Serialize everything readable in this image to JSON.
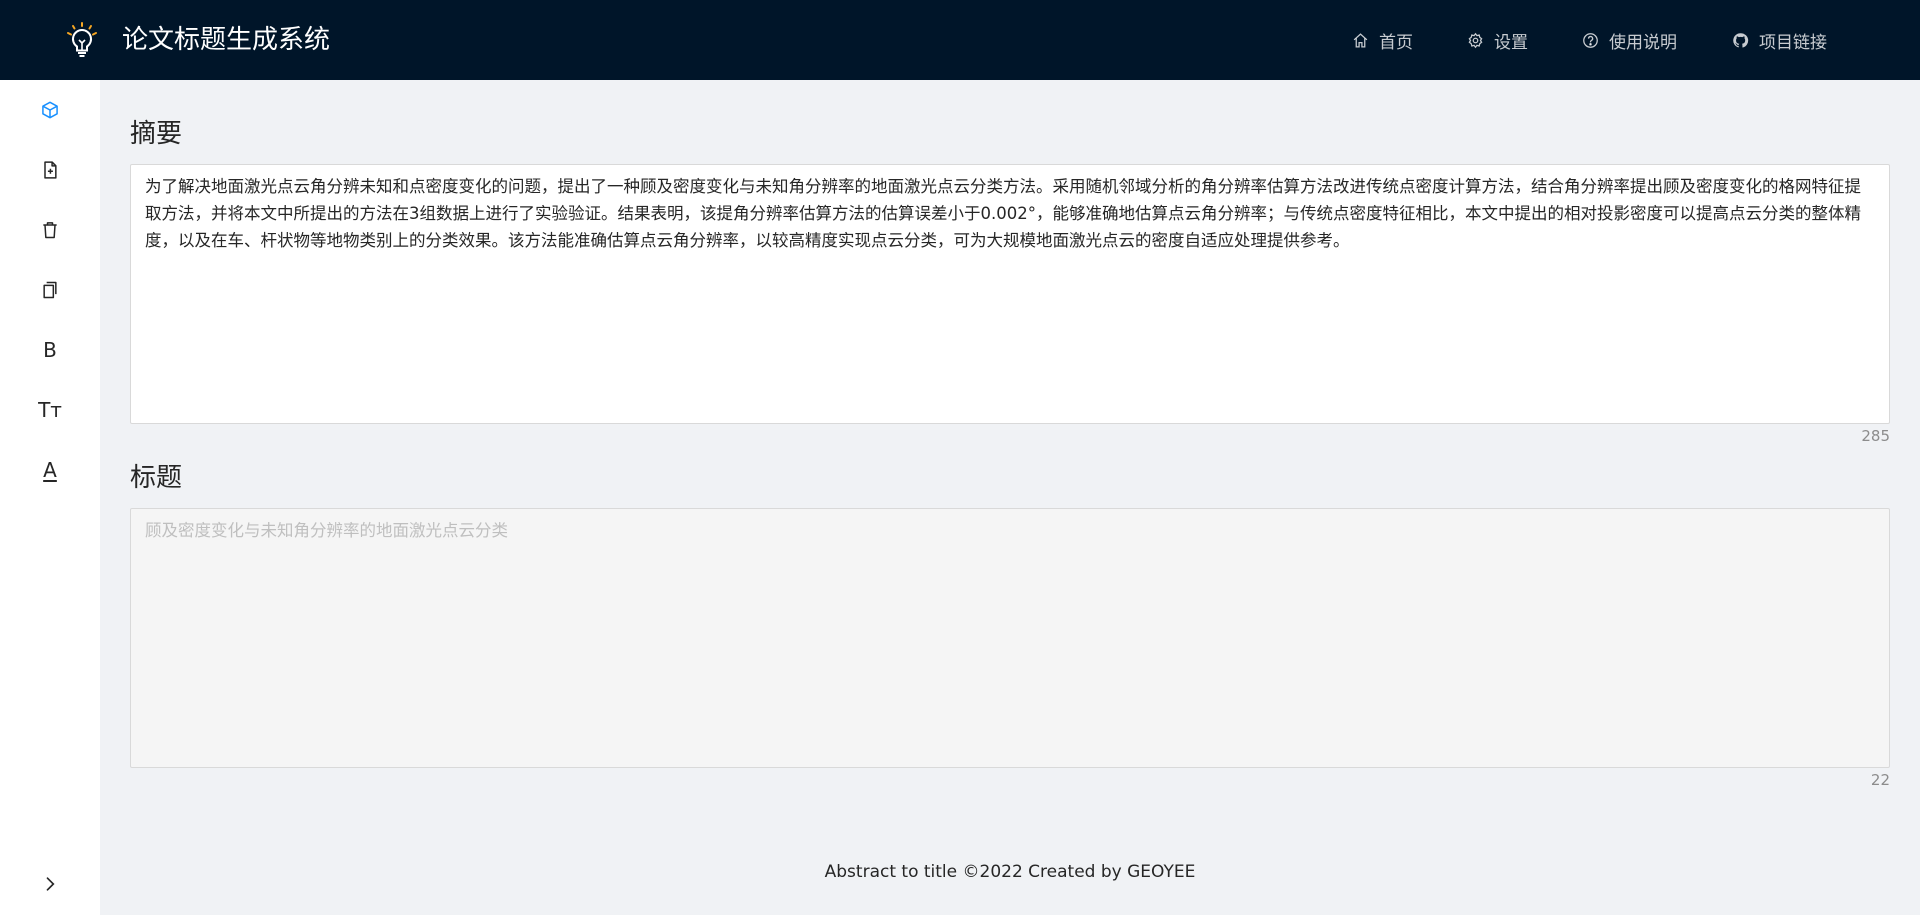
{
  "header": {
    "title": "论文标题生成系统",
    "nav": {
      "home": "首页",
      "settings": "设置",
      "help": "使用说明",
      "repo": "项目链接"
    }
  },
  "sidebar": {
    "items": [
      {
        "icon": "cube-icon"
      },
      {
        "icon": "file-add-icon"
      },
      {
        "icon": "delete-icon"
      },
      {
        "icon": "copy-icon"
      },
      {
        "icon": "bold-icon",
        "text": "B"
      },
      {
        "icon": "font-size-icon",
        "text": "Tт"
      },
      {
        "icon": "font-color-icon",
        "text": "A"
      }
    ],
    "expand_icon": "chevron-right-icon"
  },
  "abstract": {
    "label": "摘要",
    "value": "为了解决地面激光点云角分辨未知和点密度变化的问题，提出了一种顾及密度变化与未知角分辨率的地面激光点云分类方法。采用随机邻域分析的角分辨率估算方法改进传统点密度计算方法，结合角分辨率提出顾及密度变化的格网特征提取方法，并将本文中所提出的方法在3组数据上进行了实验验证。结果表明，该提角分辨率估算方法的估算误差小于0.002°，能够准确地估算点云角分辨率；与传统点密度特征相比，本文中提出的相对投影密度可以提高点云分类的整体精度，以及在车、杆状物等地物类别上的分类效果。该方法能准确估算点云角分辨率，以较高精度实现点云分类，可为大规模地面激光点云的密度自适应处理提供参考。",
    "count": "285"
  },
  "title_section": {
    "label": "标题",
    "placeholder": "顾及密度变化与未知角分辨率的地面激光点云分类",
    "count": "22"
  },
  "footer": {
    "text": "Abstract to title ©2022 Created by GEOYEE"
  },
  "colors": {
    "header_bg": "#001529",
    "accent": "#1890ff",
    "page_bg": "#f0f2f5"
  }
}
